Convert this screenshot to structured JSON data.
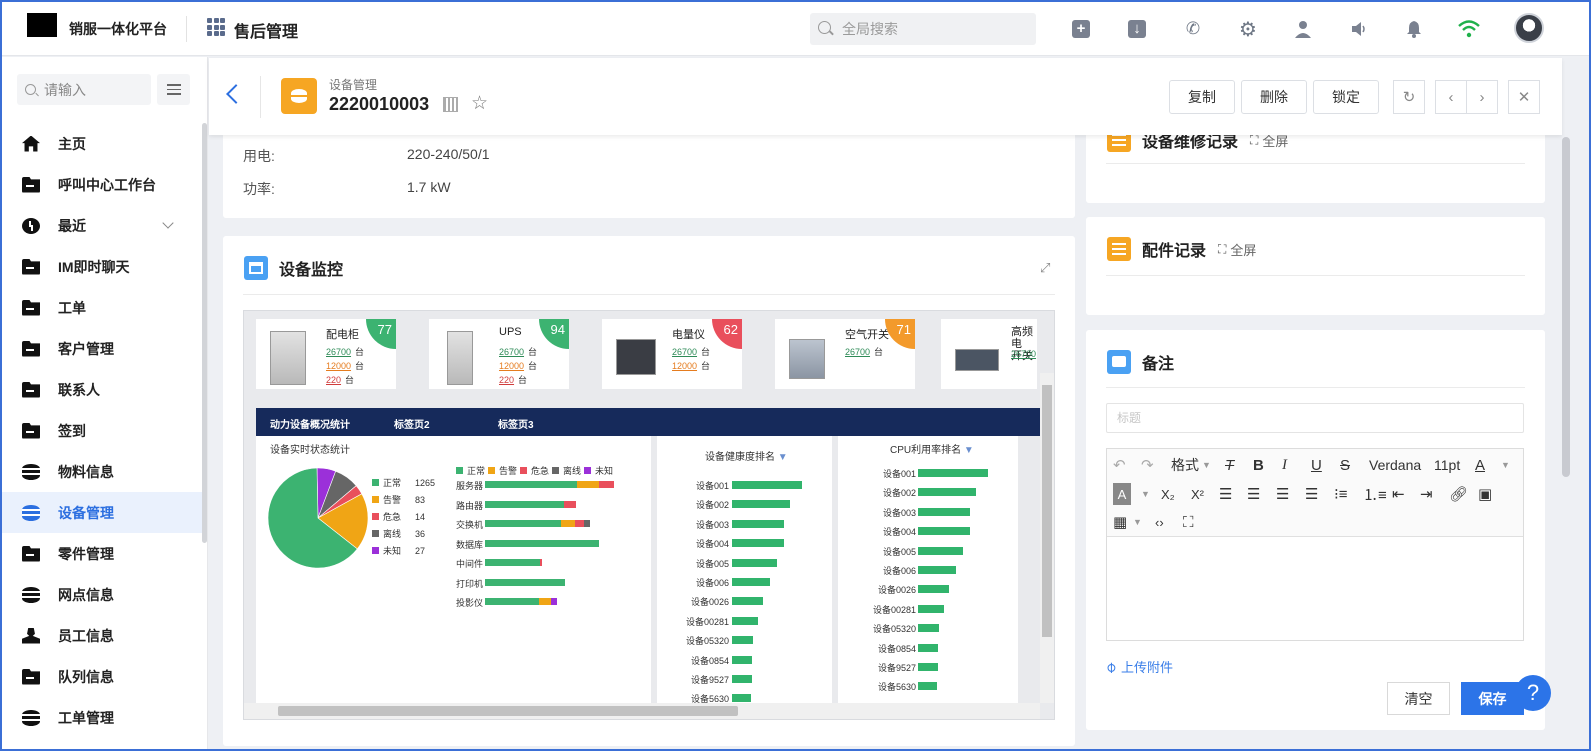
{
  "topbar": {
    "brand": "销服一体化平台",
    "module": "售后管理",
    "search_placeholder": "全局搜索",
    "icons": [
      "add-icon",
      "download-icon",
      "phone-icon",
      "gear-icon",
      "user-icon",
      "speaker-icon",
      "bell-icon",
      "wifi-icon",
      "avatar"
    ]
  },
  "sidebar": {
    "search_placeholder": "请输入",
    "items": [
      {
        "label": "主页",
        "icon": "home-icon"
      },
      {
        "label": "呼叫中心工作台",
        "icon": "folder-icon"
      },
      {
        "label": "最近",
        "icon": "clock-icon"
      },
      {
        "label": "IM即时聊天",
        "icon": "folder-icon"
      },
      {
        "label": "工单",
        "icon": "folder-icon"
      },
      {
        "label": "客户管理",
        "icon": "folder-icon"
      },
      {
        "label": "联系人",
        "icon": "folder-icon"
      },
      {
        "label": "签到",
        "icon": "folder-icon"
      },
      {
        "label": "物料信息",
        "icon": "database-icon"
      },
      {
        "label": "设备管理",
        "icon": "database-icon",
        "active": true
      },
      {
        "label": "零件管理",
        "icon": "folder-icon"
      },
      {
        "label": "网点信息",
        "icon": "database-icon"
      },
      {
        "label": "员工信息",
        "icon": "person-icon"
      },
      {
        "label": "队列信息",
        "icon": "folder-icon"
      },
      {
        "label": "工单管理",
        "icon": "database-icon"
      }
    ]
  },
  "record": {
    "type": "设备管理",
    "id": "2220010003",
    "buttons": {
      "copy": "复制",
      "delete": "删除",
      "lock": "锁定"
    }
  },
  "attributes": [
    {
      "label": "用电:",
      "value": "220-240/50/1"
    },
    {
      "label": "功率:",
      "value": "1.7 kW"
    }
  ],
  "monitor": {
    "title": "设备监控",
    "devices": [
      {
        "name": "配电柜",
        "score": "77",
        "color": "#3cb371",
        "stats": [
          "26700",
          "12000",
          "220"
        ],
        "unit": "台"
      },
      {
        "name": "UPS",
        "score": "94",
        "color": "#3cb371",
        "stats": [
          "26700",
          "12000",
          "220"
        ],
        "unit": "台"
      },
      {
        "name": "电量仪",
        "score": "62",
        "color": "#e94f5c",
        "stats": [
          "26700",
          "12000"
        ],
        "unit": "台"
      },
      {
        "name": "空气开关",
        "score": "71",
        "color": "#f39a2b",
        "stats": [
          "26700"
        ],
        "unit": "台"
      },
      {
        "name": "高频电",
        "name2": "开关",
        "score": "",
        "color": "#3cb371",
        "stats": [
          "26700"
        ],
        "unit": ""
      }
    ],
    "tabs": [
      "动力设备概况统计",
      "标签页2",
      "标签页3"
    ],
    "status_panel_title": "设备实时状态统计",
    "health_title": "设备健康度排名",
    "cpu_title": "CPU利用率排名"
  },
  "chart_data": [
    {
      "type": "pie",
      "categories": [
        "正常",
        "告警",
        "危急",
        "离线",
        "未知"
      ],
      "values": [
        1265,
        83,
        14,
        36,
        27
      ],
      "colors": [
        "#3cb371",
        "#f0a515",
        "#e94f5c",
        "#666666",
        "#9b30d9"
      ]
    },
    {
      "type": "bar",
      "orientation": "horizontal",
      "stacked": true,
      "categories": [
        "服务器",
        "路由器",
        "交换机",
        "数据库",
        "中间件",
        "打印机",
        "投影仪"
      ],
      "series": [
        {
          "name": "正常",
          "values": [
            92,
            79,
            76,
            114,
            55,
            80,
            54
          ]
        },
        {
          "name": "告警",
          "values": [
            22,
            0,
            14,
            0,
            0,
            0,
            12
          ]
        },
        {
          "name": "危急",
          "values": [
            15,
            12,
            9,
            0,
            2,
            0,
            0
          ]
        },
        {
          "name": "离线",
          "values": [
            0,
            0,
            6,
            0,
            0,
            0,
            0
          ]
        },
        {
          "name": "未知",
          "values": [
            0,
            0,
            0,
            0,
            0,
            0,
            6
          ]
        }
      ],
      "colors": [
        "#3cb371",
        "#f0a515",
        "#e94f5c",
        "#666666",
        "#9b30d9"
      ]
    },
    {
      "type": "bar",
      "orientation": "horizontal",
      "title": "设备健康度排名",
      "categories": [
        "设备001",
        "设备002",
        "设备003",
        "设备004",
        "设备005",
        "设备006",
        "设备0026",
        "设备00281",
        "设备05320",
        "设备0854",
        "设备9527",
        "设备5630"
      ],
      "values": [
        70,
        58,
        52,
        52,
        45,
        38,
        31,
        26,
        21,
        20,
        20,
        19
      ]
    },
    {
      "type": "bar",
      "orientation": "horizontal",
      "title": "CPU利用率排名",
      "categories": [
        "设备001",
        "设备002",
        "设备003",
        "设备004",
        "设备005",
        "设备006",
        "设备0026",
        "设备00281",
        "设备05320",
        "设备0854",
        "设备9527",
        "设备5630"
      ],
      "values": [
        70,
        58,
        52,
        52,
        45,
        38,
        31,
        26,
        21,
        20,
        20,
        19
      ]
    }
  ],
  "right": {
    "repair_title": "设备维修记录",
    "parts_title": "配件记录",
    "fullscreen": "全屏",
    "notes_title": "备注",
    "editor_title_placeholder": "标题",
    "toolbar": {
      "format": "格式",
      "font": "Verdana",
      "size": "11pt"
    },
    "upload": "上传附件",
    "clear": "清空",
    "save": "保存",
    "help": "?"
  }
}
